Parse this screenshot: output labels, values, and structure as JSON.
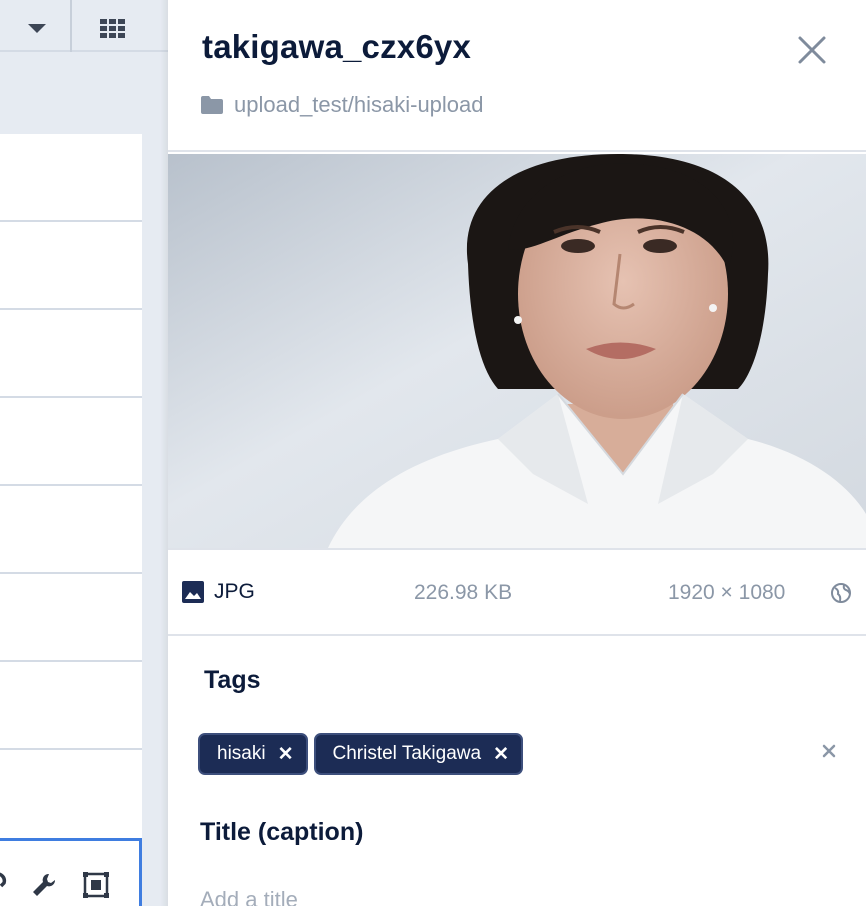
{
  "details": {
    "title": "takigawa_czx6yx",
    "folder_path": "upload_test/hisaki-upload",
    "close_icon": "close-icon",
    "folder_icon": "folder-icon",
    "meta": {
      "file_type": "JPG",
      "file_type_icon": "image-icon",
      "file_size": "226.98 KB",
      "dimensions": "1920 × 1080",
      "visibility_icon": "globe-icon"
    },
    "tags_heading": "Tags",
    "tags": [
      {
        "label": "hisaki"
      },
      {
        "label": "Christel Takigawa"
      }
    ],
    "caption_heading": "Title (caption)",
    "caption_placeholder": "Add a title"
  },
  "toolbar": {
    "dropdown_icon": "caret-down-icon",
    "view_icon": "grid-view-icon"
  },
  "asset_toolbar": {
    "icons": [
      "link-icon",
      "wrench-icon",
      "crop-focus-icon"
    ]
  },
  "colors": {
    "accent": "#3f7de0",
    "tag_bg": "#1c2c55",
    "text_primary": "#0c1b3a",
    "text_muted": "#8b97a7",
    "background": "#e6ebf2"
  }
}
